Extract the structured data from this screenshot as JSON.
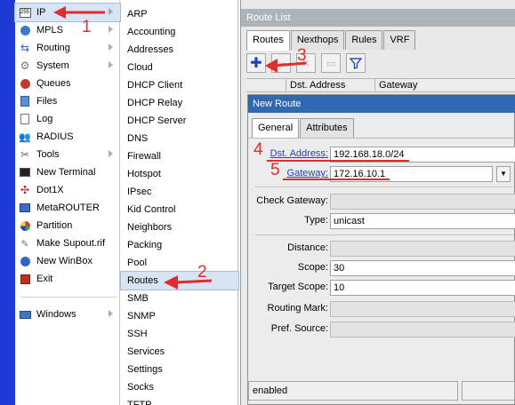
{
  "main_menu": {
    "items": [
      {
        "label": "IP",
        "icon": "ip-icon",
        "submenu": true
      },
      {
        "label": "MPLS",
        "icon": "mpls-icon",
        "submenu": true
      },
      {
        "label": "Routing",
        "icon": "routing-icon",
        "submenu": true
      },
      {
        "label": "System",
        "icon": "system-gear-icon",
        "submenu": true
      },
      {
        "label": "Queues",
        "icon": "queues-icon",
        "submenu": false
      },
      {
        "label": "Files",
        "icon": "files-icon",
        "submenu": false
      },
      {
        "label": "Log",
        "icon": "log-icon",
        "submenu": false
      },
      {
        "label": "RADIUS",
        "icon": "radius-icon",
        "submenu": false
      },
      {
        "label": "Tools",
        "icon": "tools-icon",
        "submenu": true
      },
      {
        "label": "New Terminal",
        "icon": "terminal-icon",
        "submenu": false
      },
      {
        "label": "Dot1X",
        "icon": "dot1x-icon",
        "submenu": false
      },
      {
        "label": "MetaROUTER",
        "icon": "metarouter-icon",
        "submenu": false
      },
      {
        "label": "Partition",
        "icon": "partition-icon",
        "submenu": false
      },
      {
        "label": "Make Supout.rif",
        "icon": "supout-icon",
        "submenu": false
      },
      {
        "label": "New WinBox",
        "icon": "winbox-icon",
        "submenu": false
      },
      {
        "label": "Exit",
        "icon": "exit-icon",
        "submenu": false
      },
      {
        "label": "Windows",
        "icon": "windows-icon",
        "submenu": true
      }
    ]
  },
  "ip_submenu": {
    "items": [
      "ARP",
      "Accounting",
      "Addresses",
      "Cloud",
      "DHCP Client",
      "DHCP Relay",
      "DHCP Server",
      "DNS",
      "Firewall",
      "Hotspot",
      "IPsec",
      "Kid Control",
      "Neighbors",
      "Packing",
      "Pool",
      "Routes",
      "SMB",
      "SNMP",
      "SSH",
      "Services",
      "Settings",
      "Socks",
      "TFTP"
    ]
  },
  "route_list": {
    "title": "Route List",
    "tabs": [
      "Routes",
      "Nexthops",
      "Rules",
      "VRF"
    ],
    "columns": [
      "Dst. Address",
      "Gateway"
    ]
  },
  "new_route": {
    "title": "New Route",
    "tabs": [
      "General",
      "Attributes"
    ],
    "fields": {
      "dst_address": {
        "label": "Dst. Address:",
        "value": "192.168.18.0/24"
      },
      "gateway": {
        "label": "Gateway:",
        "value": "172.16.10.1"
      },
      "check_gateway": {
        "label": "Check Gateway:",
        "value": ""
      },
      "type": {
        "label": "Type:",
        "value": "unicast"
      },
      "distance": {
        "label": "Distance:",
        "value": ""
      },
      "scope": {
        "label": "Scope:",
        "value": "30"
      },
      "target_scope": {
        "label": "Target Scope:",
        "value": "10"
      },
      "routing_mark": {
        "label": "Routing Mark:",
        "value": ""
      },
      "pref_source": {
        "label": "Pref. Source:",
        "value": ""
      }
    },
    "status": "enabled"
  },
  "annotations": [
    "1",
    "2",
    "3",
    "4",
    "5"
  ],
  "colors": {
    "annotation": "#e02c2c",
    "dialog_title": "#2f67b4",
    "left_strip": "#1e3ad6"
  }
}
